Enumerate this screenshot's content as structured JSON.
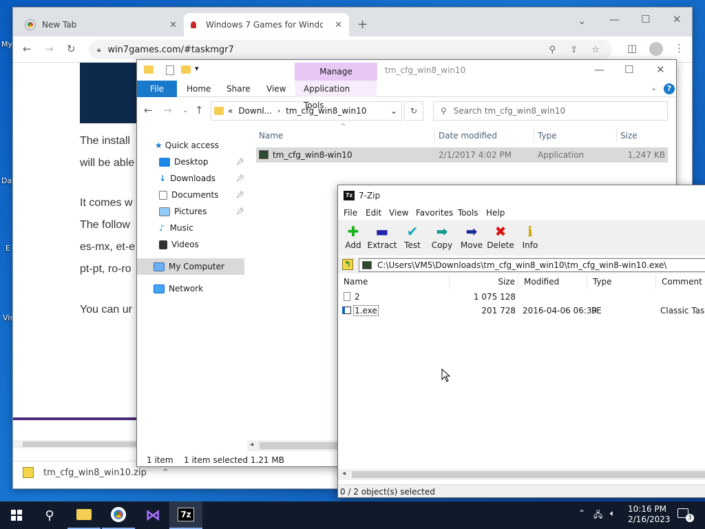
{
  "desktop": {
    "icon_labels": [
      "My",
      "Da",
      "E",
      "Vis"
    ]
  },
  "chrome": {
    "tabs": [
      {
        "label": "New Tab"
      },
      {
        "label": "Windows 7 Games for Windows"
      }
    ],
    "url": "win7games.com/#taskmgr7",
    "page_text": [
      "The install",
      "will be able",
      "It comes w",
      "The follow",
      "es-mx, et-e",
      "pt-pt, ro-ro",
      "You can ur"
    ],
    "download_file": "tm_cfg_win8_win10.zip"
  },
  "explorer": {
    "title": "tm_cfg_win8_win10",
    "manage_label": "Manage",
    "ribbon_tabs": [
      "File",
      "Home",
      "Share",
      "View",
      "Application Tools"
    ],
    "address_prefix": "«",
    "address_parts": [
      "Downl...",
      "tm_cfg_win8_win10"
    ],
    "search_placeholder": "Search tm_cfg_win8_win10",
    "nav": [
      {
        "label": "Quick access",
        "pinned": false
      },
      {
        "label": "Desktop",
        "pinned": true
      },
      {
        "label": "Downloads",
        "pinned": true
      },
      {
        "label": "Documents",
        "pinned": true
      },
      {
        "label": "Pictures",
        "pinned": true
      },
      {
        "label": "Music",
        "pinned": false
      },
      {
        "label": "Videos",
        "pinned": false
      },
      {
        "label": "My Computer",
        "pinned": false
      },
      {
        "label": "Network",
        "pinned": false
      }
    ],
    "columns": [
      "Name",
      "Date modified",
      "Type",
      "Size"
    ],
    "files": [
      {
        "name": "tm_cfg_win8-win10",
        "date": "2/1/2017 4:02 PM",
        "type": "Application",
        "size": "1,247 KB"
      }
    ],
    "status": {
      "count": "1 item",
      "selected": "1 item selected  1.21 MB"
    }
  },
  "zip": {
    "title": "7-Zip",
    "title_icon": "7z",
    "menu": [
      "File",
      "Edit",
      "View",
      "Favorites",
      "Tools",
      "Help"
    ],
    "tools": [
      {
        "label": "Add",
        "glyph": "✚",
        "color": "#19b319"
      },
      {
        "label": "Extract",
        "glyph": "▬",
        "color": "#2222aa"
      },
      {
        "label": "Test",
        "glyph": "✔",
        "color": "#11aabb"
      },
      {
        "label": "Copy",
        "glyph": "➡",
        "color": "#11998a"
      },
      {
        "label": "Move",
        "glyph": "➡",
        "color": "#1a2a99"
      },
      {
        "label": "Delete",
        "glyph": "✖",
        "color": "#dd1111"
      },
      {
        "label": "Info",
        "glyph": "ℹ",
        "color": "#c9a400"
      }
    ],
    "path": "C:\\Users\\VM5\\Downloads\\tm_cfg_win8_win10\\tm_cfg_win8-win10.exe\\",
    "columns": [
      "Name",
      "Size",
      "Modified",
      "Type",
      "Comment"
    ],
    "rows": [
      {
        "name": "2",
        "size": "1 075 128",
        "modified": "",
        "type": "",
        "comment": ""
      },
      {
        "name": "1.exe",
        "size": "201 728",
        "modified": "2016-04-06 06:39",
        "type": "PE",
        "comment": "Classic Task"
      }
    ],
    "status": "0 / 2 object(s) selected"
  },
  "taskbar": {
    "app_7z_label": "7z",
    "time": "10:16 PM",
    "date": "2/16/2023",
    "notification_count": "3"
  }
}
